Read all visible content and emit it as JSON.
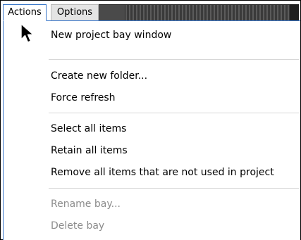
{
  "tabs": {
    "actions": "Actions",
    "options": "Options"
  },
  "menu": {
    "items": [
      {
        "label": "New project bay window",
        "enabled": true
      },
      {
        "label": "Create new folder...",
        "enabled": true
      },
      {
        "label": "Force refresh",
        "enabled": true
      },
      {
        "label": "Select all items",
        "enabled": true
      },
      {
        "label": "Retain all items",
        "enabled": true
      },
      {
        "label": "Remove all items that are not used in project",
        "enabled": true
      },
      {
        "label": "Rename bay...",
        "enabled": false
      },
      {
        "label": "Delete bay",
        "enabled": false
      }
    ]
  },
  "colors": {
    "active_tab_border": "#3a77c9",
    "disabled_text": "#8d8d8d",
    "separator": "#d7d7d7",
    "toolbar_strip": "#3f3f3f"
  },
  "icons": {
    "cursor": "mouse-pointer-icon"
  }
}
